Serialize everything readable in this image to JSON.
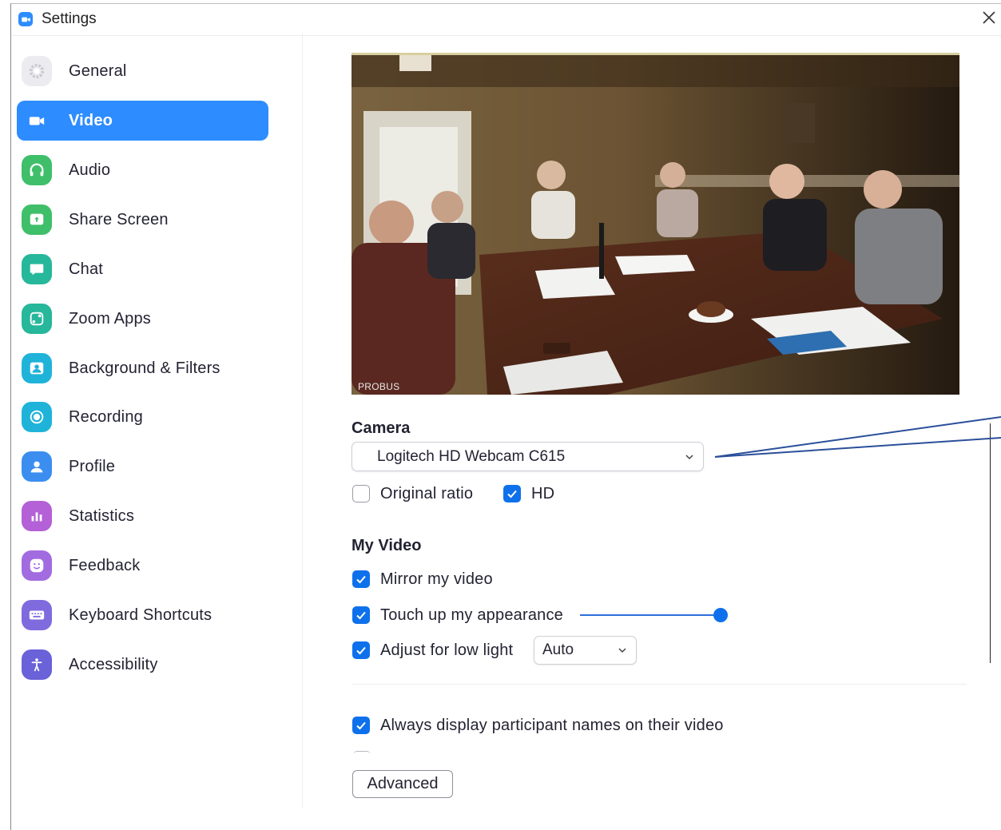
{
  "window": {
    "title": "Settings",
    "app_icon": "zoom-camera-icon",
    "close_icon": "close-icon"
  },
  "sidebar": {
    "items": [
      {
        "label": "General",
        "icon": "gear-icon",
        "color": "#e9e9ee",
        "active": false
      },
      {
        "label": "Video",
        "icon": "video-camera-icon",
        "color": "#2d8cff",
        "active": true
      },
      {
        "label": "Audio",
        "icon": "headphones-icon",
        "color": "#3fbf6a",
        "active": false
      },
      {
        "label": "Share Screen",
        "icon": "share-screen-icon",
        "color": "#3fbf6a",
        "active": false
      },
      {
        "label": "Chat",
        "icon": "chat-bubble-icon",
        "color": "#27b79a",
        "active": false
      },
      {
        "label": "Zoom Apps",
        "icon": "apps-icon",
        "color": "#27b79a",
        "active": false
      },
      {
        "label": "Background & Filters",
        "icon": "background-icon",
        "color": "#1fb3d9",
        "active": false
      },
      {
        "label": "Recording",
        "icon": "record-icon",
        "color": "#1fb3d9",
        "active": false
      },
      {
        "label": "Profile",
        "icon": "person-icon",
        "color": "#3b8ef0",
        "active": false
      },
      {
        "label": "Statistics",
        "icon": "bar-chart-icon",
        "color": "#b460d6",
        "active": false
      },
      {
        "label": "Feedback",
        "icon": "smiley-icon",
        "color": "#a26ce0",
        "active": false
      },
      {
        "label": "Keyboard Shortcuts",
        "icon": "keyboard-icon",
        "color": "#7f6bde",
        "active": false
      },
      {
        "label": "Accessibility",
        "icon": "accessibility-icon",
        "color": "#6a62d8",
        "active": false
      }
    ]
  },
  "preview": {
    "label": "PROBUS"
  },
  "camera": {
    "title": "Camera",
    "selected": "Logitech HD Webcam C615",
    "original_ratio": {
      "label": "Original ratio",
      "checked": false
    },
    "hd": {
      "label": "HD",
      "checked": true
    }
  },
  "my_video": {
    "title": "My Video",
    "mirror": {
      "label": "Mirror my video",
      "checked": true
    },
    "touch_up": {
      "label": "Touch up my appearance",
      "checked": true,
      "level": 1.0
    },
    "low_light": {
      "label": "Adjust for low light",
      "checked": true,
      "mode": "Auto"
    }
  },
  "participant_names": {
    "label": "Always display participant names on their video",
    "checked": true
  },
  "advanced_button": "Advanced",
  "colors": {
    "accent": "#2d8cff",
    "checkbox": "#0e71eb",
    "callout_line": "#2a4f9a"
  }
}
